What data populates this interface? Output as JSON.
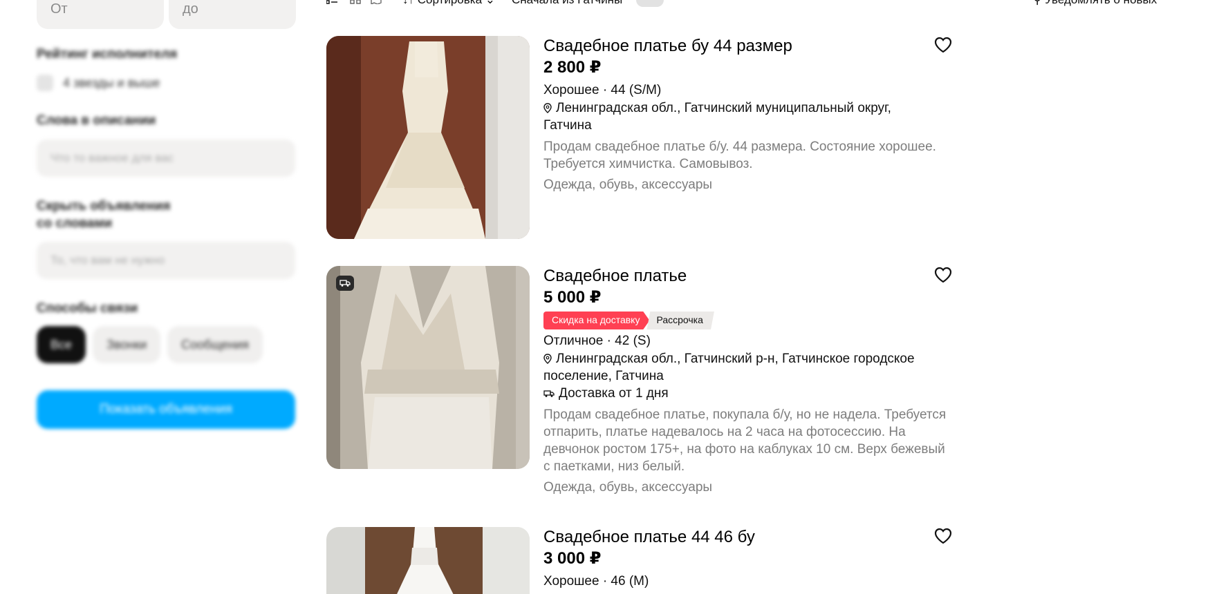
{
  "filters": {
    "price_from_placeholder": "От",
    "price_to_placeholder": "до",
    "seller_rating_title": "Рейтинг исполнителя",
    "rating_option": "4 звезды и выше",
    "words_in_description_title": "Слова в описании",
    "words_in_description_placeholder": "Что то важное для вас",
    "hide_by_words_title_line1": "Скрыть объявления",
    "hide_by_words_title_line2": "со словами",
    "hide_by_words_placeholder": "То, что вам не нужно",
    "contact_methods_title": "Способы связи",
    "contact_options": [
      "Все",
      "Звонки",
      "Сообщения"
    ],
    "show_button": "Показать объявления"
  },
  "toolbar": {
    "sort_label": "Сортировка",
    "first_from_label": "Сначала из Гатчины",
    "notify_label": "Уведомлять о новых"
  },
  "listings": [
    {
      "title": "Свадебное платье бу 44 размер",
      "price": "2 800 ₽",
      "condition": "Хорошее · 44 (S/M)",
      "location_line1": "Ленинградская обл., Гатчинский муниципальный округ,",
      "location_line2": "Гатчина",
      "description": "Продам свадебное платье б/у. 44 размера. Состояние хорошее. Требуется химчистка. Самовывоз.",
      "category": "Одежда, обувь, аксессуары"
    },
    {
      "title": "Свадебное платье",
      "price": "5 000 ₽",
      "badge_discount": "Скидка на доставку",
      "badge_installment": "Рассрочка",
      "condition": "Отличное · 42 (S)",
      "location_line1": "Ленинградская обл., Гатчинский р-н, Гатчинское городское",
      "location_line2": "поселение, Гатчина",
      "delivery": "Доставка от 1 дня",
      "description": "Продам свадебное платье, покупала б/у, но не надела. Требуется отпарить, платье надевалось на 2 часа на фотосессию. На девчонок ростом 175+, на фото на каблуках 10 см. Верх бежевый с паетками, низ белый.",
      "category": "Одежда, обувь, аксессуары"
    },
    {
      "title": "Свадебное платье 44 46 бу",
      "price": "3 000 ₽",
      "condition": "Хорошее · 46 (M)"
    }
  ],
  "colors": {
    "accent_blue": "#00aaff",
    "badge_red": "#ff4053",
    "muted_text": "#7d7d7d"
  }
}
